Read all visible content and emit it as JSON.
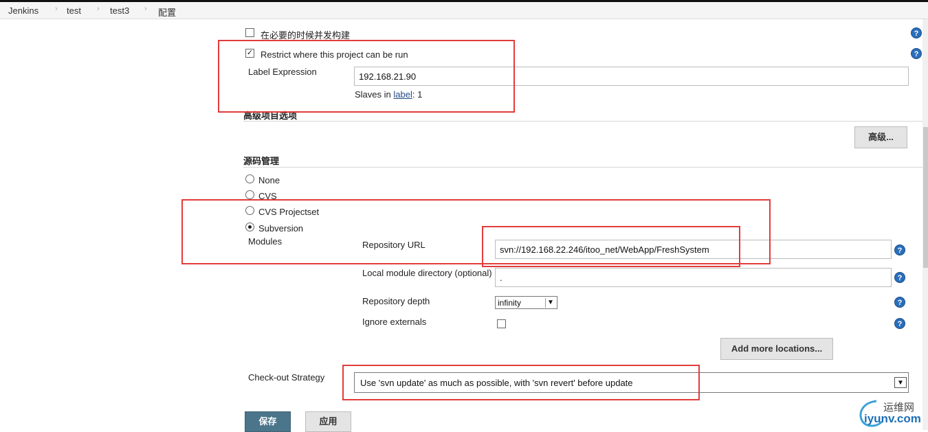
{
  "breadcrumb": [
    "Jenkins",
    "test",
    "test3",
    "配置"
  ],
  "options": {
    "build_if_needed": "在必要的时候并发构建",
    "restrict_label": "Restrict where this project can be run",
    "label_expression": "Label Expression",
    "label_value": "192.168.21.90",
    "slaves_prefix": "Slaves in ",
    "slaves_link": "label",
    "slaves_count": ": 1"
  },
  "advanced_section": {
    "title": "高级项目选项",
    "advanced_button": "高级..."
  },
  "scm": {
    "title": "源码管理",
    "options": [
      "None",
      "CVS",
      "CVS Projectset",
      "Subversion"
    ],
    "selected": "Subversion",
    "modules_label": "Modules",
    "repo_url_label": "Repository URL",
    "repo_url_value": "svn://192.168.22.246/itoo_net/WebApp/FreshSystem",
    "local_dir_label": "Local module directory (optional)",
    "local_dir_value": ".",
    "depth_label": "Repository depth",
    "depth_value": "infinity",
    "ignore_label": "Ignore externals",
    "add_locations": "Add more locations...",
    "checkout_label": "Check-out Strategy",
    "checkout_value": "Use 'svn update' as much as possible, with 'svn revert' before update"
  },
  "footer": {
    "save": "保存",
    "apply": "应用"
  },
  "watermark": {
    "cn": "运维网",
    "url": "iyunv.com"
  },
  "help_glyph": "?",
  "colors": {
    "save_button": "#4b758b",
    "highlight": "#e23b3b",
    "help_icon": "#2a6ebb"
  }
}
